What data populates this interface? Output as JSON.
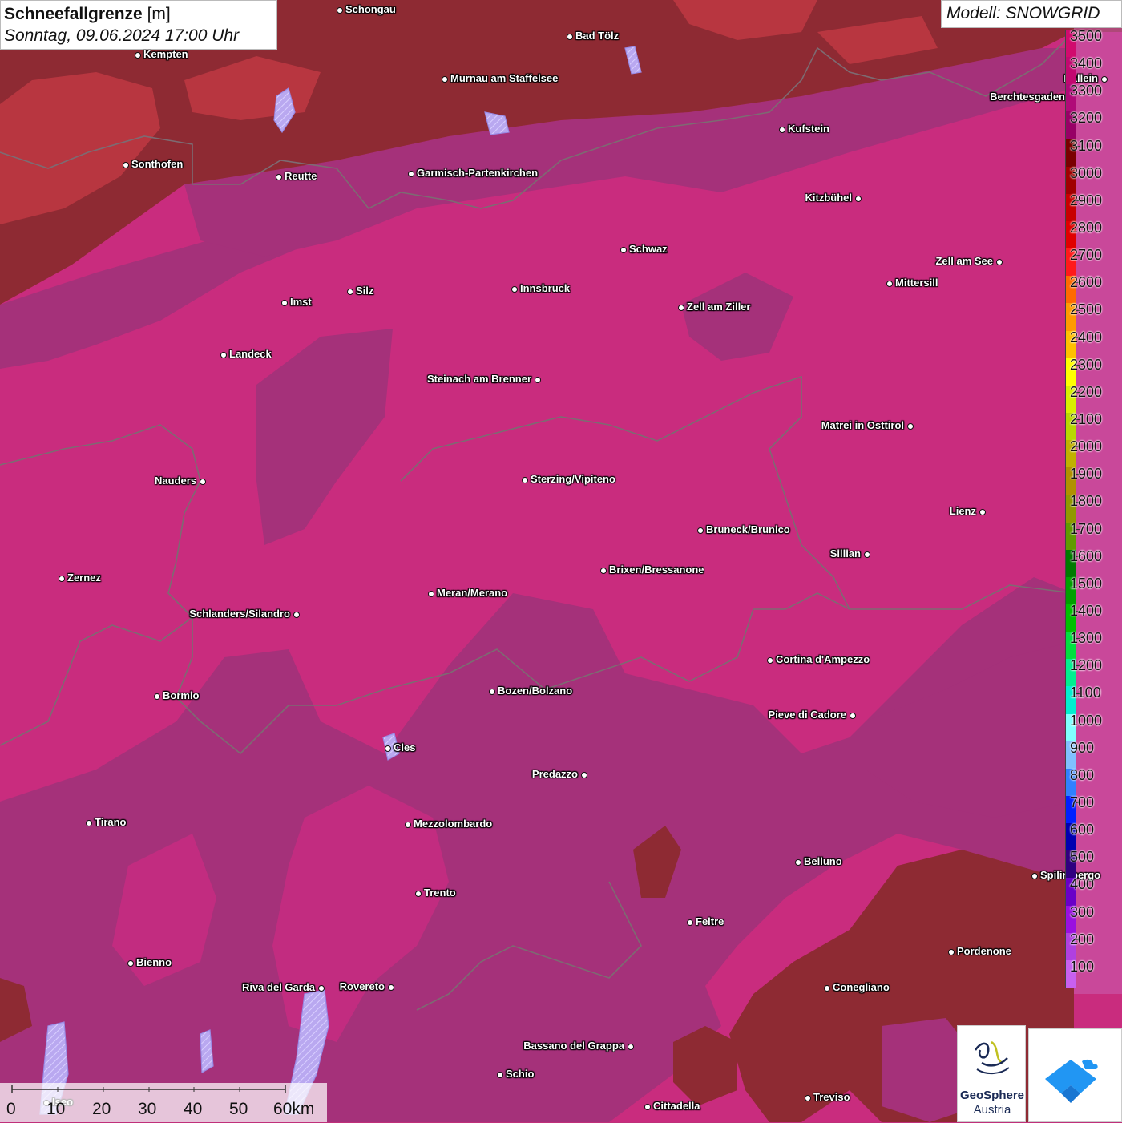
{
  "title": {
    "parameter": "Schneefallgrenze",
    "unit": "[m]",
    "datetime": "Sonntag, 09.06.2024 17:00 Uhr"
  },
  "model_label": "Modell: SNOWGRID",
  "colors": {
    "dark_red": "#8e2a2a",
    "red_area": "#c83a3a",
    "purple_area": "#a02a7a",
    "pink_area": "#c92c7e",
    "border_line": "#7a6a70",
    "lake": "#8fb0f0"
  },
  "legend": [
    {
      "value": "3500",
      "color": "#d10b6e"
    },
    {
      "value": "3400",
      "color": "#c20870"
    },
    {
      "value": "3300",
      "color": "#b00a78"
    },
    {
      "value": "3200",
      "color": "#980066"
    },
    {
      "value": "3100",
      "color": "#7a0000"
    },
    {
      "value": "3000",
      "color": "#a00000"
    },
    {
      "value": "2900",
      "color": "#c80000"
    },
    {
      "value": "2800",
      "color": "#e00000"
    },
    {
      "value": "2700",
      "color": "#ff1a1a"
    },
    {
      "value": "2600",
      "color": "#ff6a00"
    },
    {
      "value": "2500",
      "color": "#ff9a00"
    },
    {
      "value": "2400",
      "color": "#ffc000"
    },
    {
      "value": "2300",
      "color": "#ffff00"
    },
    {
      "value": "2200",
      "color": "#d8f000"
    },
    {
      "value": "2100",
      "color": "#b8d800"
    },
    {
      "value": "2000",
      "color": "#c0b000"
    },
    {
      "value": "1900",
      "color": "#b09000"
    },
    {
      "value": "1800",
      "color": "#909800"
    },
    {
      "value": "1700",
      "color": "#609a00"
    },
    {
      "value": "1600",
      "color": "#007a00"
    },
    {
      "value": "1500",
      "color": "#00a000"
    },
    {
      "value": "1400",
      "color": "#00c000"
    },
    {
      "value": "1300",
      "color": "#00e040"
    },
    {
      "value": "1200",
      "color": "#00f090"
    },
    {
      "value": "1100",
      "color": "#00f0d0"
    },
    {
      "value": "1000",
      "color": "#80ffff"
    },
    {
      "value": "900",
      "color": "#80c0ff"
    },
    {
      "value": "800",
      "color": "#3080ff"
    },
    {
      "value": "700",
      "color": "#0020ff"
    },
    {
      "value": "600",
      "color": "#0000b0"
    },
    {
      "value": "500",
      "color": "#300080"
    },
    {
      "value": "400",
      "color": "#6a00c8"
    },
    {
      "value": "300",
      "color": "#9a10e0"
    },
    {
      "value": "200",
      "color": "#b040e0"
    },
    {
      "value": "100",
      "color": "#c860f0"
    }
  ],
  "cities": [
    {
      "name": "Schongau"
    },
    {
      "name": "Bad Tölz"
    },
    {
      "name": "Kempten"
    },
    {
      "name": "Murnau am Staffelsee"
    },
    {
      "name": "Hallein"
    },
    {
      "name": "Berchtesgaden"
    },
    {
      "name": "Kufstein"
    },
    {
      "name": "Sonthofen"
    },
    {
      "name": "Reutte"
    },
    {
      "name": "Garmisch-Partenkirchen"
    },
    {
      "name": "Kitzbühel"
    },
    {
      "name": "Schwaz"
    },
    {
      "name": "Zell am See"
    },
    {
      "name": "Mittersill"
    },
    {
      "name": "Innsbruck"
    },
    {
      "name": "Silz"
    },
    {
      "name": "Imst"
    },
    {
      "name": "Zell am Ziller"
    },
    {
      "name": "Landeck"
    },
    {
      "name": "Steinach am Brenner"
    },
    {
      "name": "Matrei in Osttirol"
    },
    {
      "name": "Nauders"
    },
    {
      "name": "Sterzing/Vipiteno"
    },
    {
      "name": "Lienz"
    },
    {
      "name": "Bruneck/Brunico"
    },
    {
      "name": "Sillian"
    },
    {
      "name": "Zernez"
    },
    {
      "name": "Brixen/Bressanone"
    },
    {
      "name": "Meran/Merano"
    },
    {
      "name": "Schlanders/Silandro"
    },
    {
      "name": "Cortina d'Ampezzo"
    },
    {
      "name": "Bozen/Bolzano"
    },
    {
      "name": "Bormio"
    },
    {
      "name": "Pieve di Cadore"
    },
    {
      "name": "Cles"
    },
    {
      "name": "Predazzo"
    },
    {
      "name": "Tirano"
    },
    {
      "name": "Mezzolombardo"
    },
    {
      "name": "Belluno"
    },
    {
      "name": "Spilimbergo"
    },
    {
      "name": "Trento"
    },
    {
      "name": "Feltre"
    },
    {
      "name": "Pordenone"
    },
    {
      "name": "Bienno"
    },
    {
      "name": "Riva del Garda"
    },
    {
      "name": "Rovereto"
    },
    {
      "name": "Conegliano"
    },
    {
      "name": "Bassano del Grappa"
    },
    {
      "name": "Schio"
    },
    {
      "name": "Treviso"
    },
    {
      "name": "Cittadella"
    },
    {
      "name": "Iseo"
    }
  ],
  "scale_bar": {
    "labels": [
      "0",
      "10",
      "20",
      "30",
      "40",
      "50",
      "60km"
    ]
  },
  "logos": {
    "geosphere_line1": "GeoSphere",
    "geosphere_line2": "Austria"
  }
}
